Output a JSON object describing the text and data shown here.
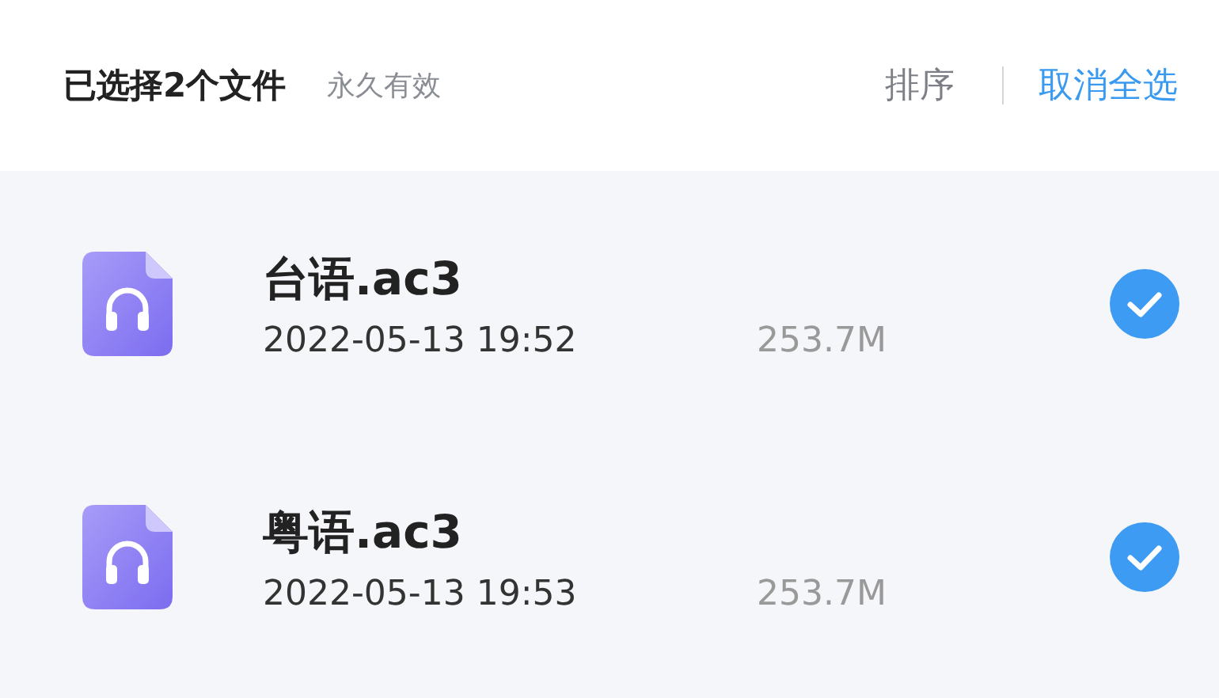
{
  "header": {
    "title": "已选择2个文件",
    "subtitle": "永久有效",
    "sort": "排序",
    "deselect_all": "取消全选"
  },
  "files": [
    {
      "name": "台语.ac3",
      "date": "2022-05-13 19:52",
      "size": "253.7M",
      "selected": true
    },
    {
      "name": "粤语.ac3",
      "date": "2022-05-13 19:53",
      "size": "253.7M",
      "selected": true
    }
  ]
}
